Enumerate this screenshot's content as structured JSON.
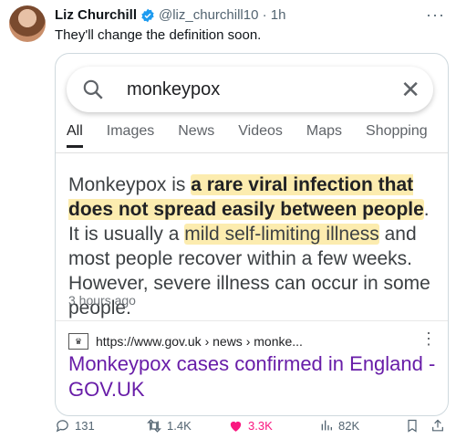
{
  "tweet": {
    "display_name": "Liz Churchill",
    "handle": "@liz_churchill10",
    "time": "1h",
    "text": "They'll change the definition soon."
  },
  "screenshot": {
    "search_query": "monkeypox",
    "tabs": [
      "All",
      "Images",
      "News",
      "Videos",
      "Maps",
      "Shopping"
    ],
    "active_tab": "All",
    "snippet": {
      "p1": "Monkeypox is ",
      "p2": "a rare viral infection that does not spread easily between people",
      "p3": ". It is usually a ",
      "p4": "mild self-limiting illness",
      "p5": " and most people recover within a few weeks. However, severe illness can occur in some people."
    },
    "age": "3 hours ago",
    "result_url": "https://www.gov.uk › news › monke...",
    "result_title": "Monkeypox cases confirmed in England - GOV.UK"
  },
  "actions": {
    "replies": "131",
    "retweets": "1.4K",
    "likes": "3.3K",
    "views": "82K"
  },
  "colors": {
    "like": "#f91880",
    "verified": "#1d9bf0",
    "result_title": "#681da8"
  }
}
